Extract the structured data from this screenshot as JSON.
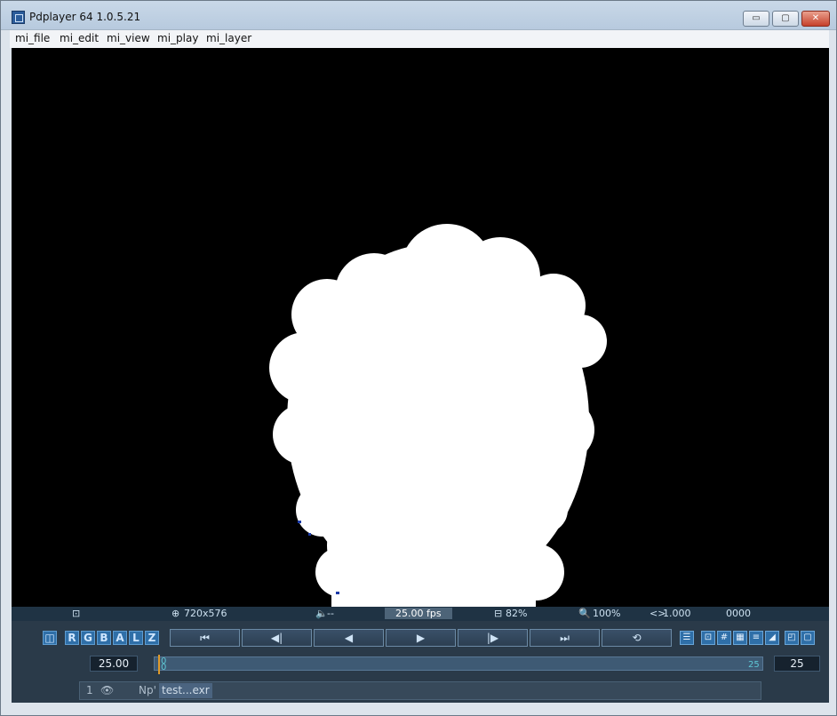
{
  "window": {
    "title": "Pdplayer 64 1.0.5.21",
    "buttons": {
      "minimize": "▭",
      "maximize": "▢",
      "close": "✕"
    }
  },
  "menu": [
    "mi_file",
    "mi_edit",
    "mi_view",
    "mi_play",
    "mi_layer"
  ],
  "status": {
    "resolution": "720x576",
    "audio": "--",
    "fps": "25.00 fps",
    "quality": "82%",
    "zoom": "100%",
    "aspect": "1.000",
    "frame": "0000"
  },
  "channels": [
    "R",
    "G",
    "B",
    "A",
    "L",
    "Z"
  ],
  "transport": {
    "first": "⏮",
    "step_back": "◀|",
    "play_back": "◀",
    "play": "▶",
    "step_forward": "|▶",
    "last": "⏭",
    "loop": "⟲"
  },
  "fields": {
    "fps_value": "25.00",
    "end_frame": "25"
  },
  "timeline": {
    "start_top": "0",
    "start_bottom": "0",
    "end": "25"
  },
  "layer": {
    "index": "1",
    "label": "Np'",
    "file": "test...exr"
  }
}
